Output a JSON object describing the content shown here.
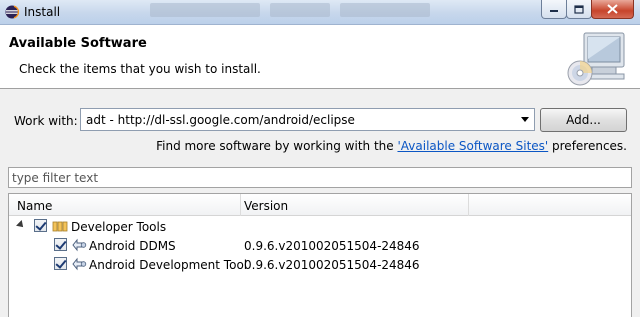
{
  "window": {
    "title": "Install"
  },
  "header": {
    "title": "Available Software",
    "description": "Check the items that you wish to install."
  },
  "work_with": {
    "label": "Work with:",
    "value": "adt - http://dl-ssl.google.com/android/eclipse",
    "add_button": "Add..."
  },
  "more_software": {
    "prefix": "Find more software by working with the ",
    "link": "'Available Software Sites'",
    "suffix": " preferences."
  },
  "filter": {
    "placeholder": "type filter text"
  },
  "table": {
    "columns": [
      "Name",
      "Version"
    ],
    "group": {
      "name": "Developer Tools",
      "checked": true,
      "expanded": true
    },
    "rows": [
      {
        "name": "Android DDMS",
        "version": "0.9.6.v201002051504-24846",
        "checked": true
      },
      {
        "name": "Android Development Tool",
        "version": "0.9.6.v201002051504-24846",
        "checked": true
      }
    ]
  },
  "icons": {
    "app": "eclipse-icon",
    "banner": "install-cd-monitor-icon",
    "group": "category-icon",
    "feature": "feature-plugin-icon"
  },
  "colors": {
    "link": "#0b56c4",
    "close_button": "#c7442b"
  }
}
